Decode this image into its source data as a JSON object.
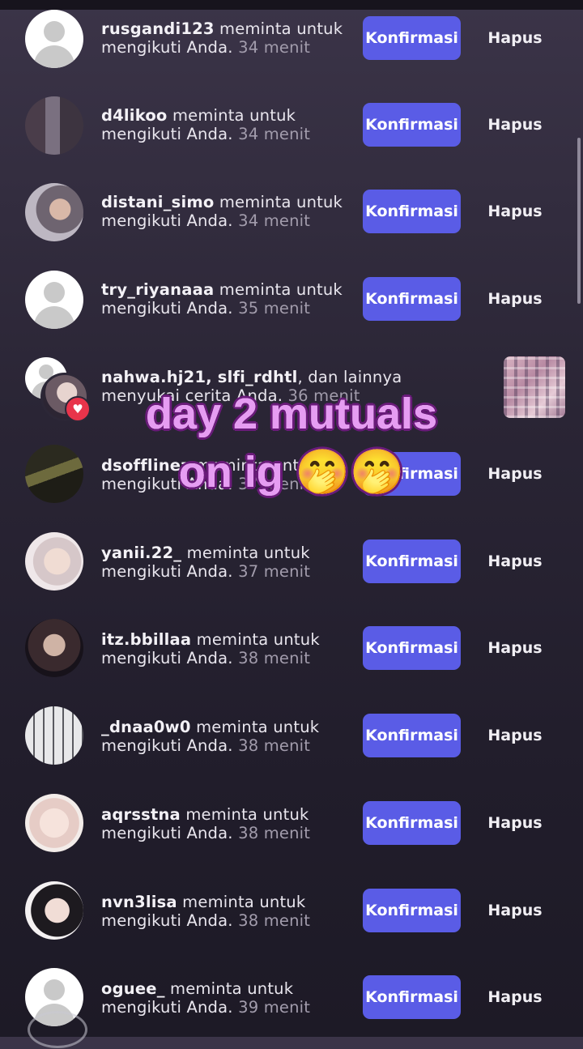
{
  "requests": [
    {
      "username": "rusgandi123",
      "text": " meminta untuk mengikuti Anda. ",
      "time": "34 menit",
      "confirm": "Konfirmasi",
      "delete": "Hapus",
      "avatar": "default-avatar"
    },
    {
      "username": "d4likoo",
      "text": " meminta untuk mengikuti Anda. ",
      "time": "34 menit",
      "confirm": "Konfirmasi",
      "delete": "Hapus",
      "avatar": "photo-avatar"
    },
    {
      "username": "distani_simo",
      "text": " meminta untuk mengikuti Anda. ",
      "time": "34 menit",
      "confirm": "Konfirmasi",
      "delete": "Hapus",
      "avatar": "photo-avatar"
    },
    {
      "username": "try_riyanaaa",
      "text": " meminta untuk mengikuti Anda. ",
      "time": "35 menit",
      "confirm": "Konfirmasi",
      "delete": "Hapus",
      "avatar": "default-avatar"
    },
    {
      "username": "dsofflinez",
      "text": " meminta untuk mengikuti Anda. ",
      "time": "37 menit",
      "confirm": "Konfirmasi",
      "delete": "Hapus",
      "avatar": "photo-avatar"
    },
    {
      "username": "yanii.22_",
      "text": " meminta untuk mengikuti Anda. ",
      "time": "37 menit",
      "confirm": "Konfirmasi",
      "delete": "Hapus",
      "avatar": "photo-avatar"
    },
    {
      "username": "itz.bbillaa",
      "text": " meminta untuk mengikuti Anda. ",
      "time": "38 menit",
      "confirm": "Konfirmasi",
      "delete": "Hapus",
      "avatar": "photo-avatar"
    },
    {
      "username": "_dnaa0w0",
      "text": " meminta untuk mengikuti Anda. ",
      "time": "38 menit",
      "confirm": "Konfirmasi",
      "delete": "Hapus",
      "avatar": "photo-avatar"
    },
    {
      "username": "aqrsstna",
      "text": " meminta untuk mengikuti Anda. ",
      "time": "38 menit",
      "confirm": "Konfirmasi",
      "delete": "Hapus",
      "avatar": "photo-avatar"
    },
    {
      "username": "nvn3lisa",
      "text": " meminta untuk mengikuti Anda. ",
      "time": "38 menit",
      "confirm": "Konfirmasi",
      "delete": "Hapus",
      "avatar": "photo-avatar"
    },
    {
      "username": "oguee_",
      "text": " meminta untuk mengikuti Anda. ",
      "time": "39 menit",
      "confirm": "Konfirmasi",
      "delete": "Hapus",
      "avatar": "default-avatar"
    }
  ],
  "like_notification": {
    "usernames": "nahwa.hj21, slfi_rdhtl",
    "text": ", dan lainnya menyukai cerita Anda. ",
    "time": "36 menit",
    "badge_icon": "heart-icon"
  },
  "overlay_caption": {
    "line1": "day 2 mutuals",
    "line2": "on ig 🤭🤭"
  },
  "colors": {
    "confirm_button": "#5a5ce6",
    "heart_badge": "#e8344b",
    "caption": "#e69cf2",
    "caption_outline": "#6a1b7a"
  }
}
